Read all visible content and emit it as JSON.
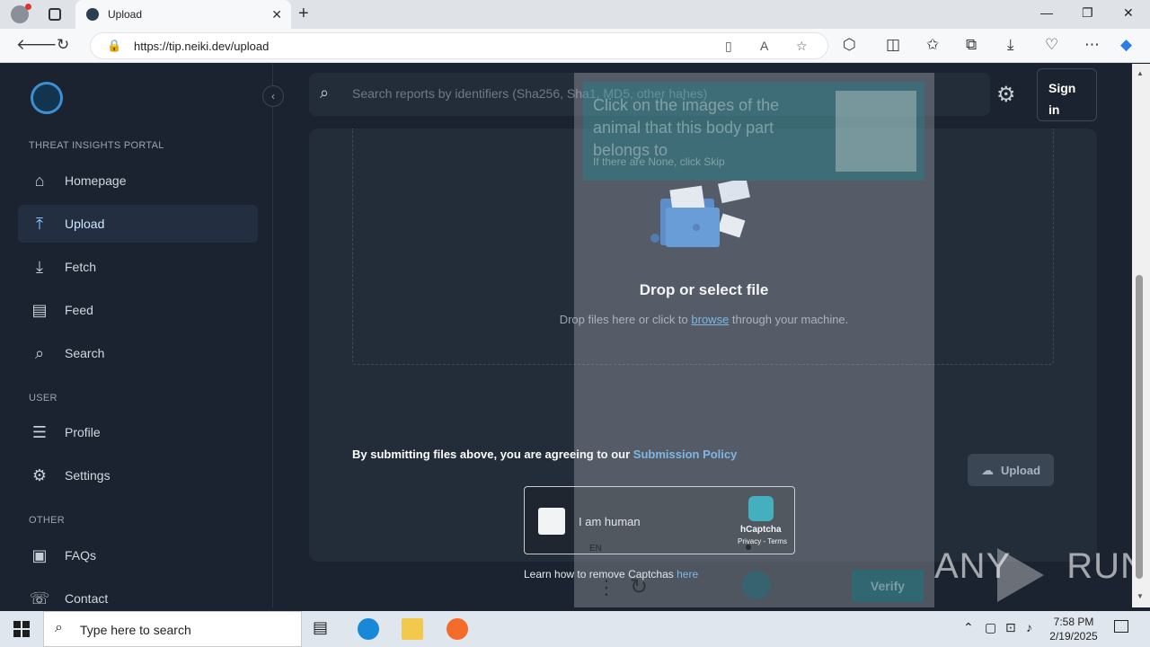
{
  "browser": {
    "tab_title": "Upload",
    "url": "https://tip.neiki.dev/upload",
    "new_tab_symbol": "+",
    "window_controls": [
      "—",
      "❐",
      "✕"
    ]
  },
  "sidebar": {
    "portal_label": "THREAT INSIGHTS PORTAL",
    "main_items": [
      {
        "label": "Homepage",
        "icon": "home-icon"
      },
      {
        "label": "Upload",
        "icon": "upload-icon",
        "active": true
      },
      {
        "label": "Fetch",
        "icon": "download-icon"
      },
      {
        "label": "Feed",
        "icon": "feed-icon"
      },
      {
        "label": "Search",
        "icon": "search-icon"
      }
    ],
    "user_label": "USER",
    "user_items": [
      {
        "label": "Profile",
        "icon": "profile-icon"
      },
      {
        "label": "Settings",
        "icon": "gear-icon"
      }
    ],
    "other_label": "OTHER",
    "other_items": [
      {
        "label": "FAQs",
        "icon": "faq-icon"
      },
      {
        "label": "Contact",
        "icon": "contact-icon"
      }
    ]
  },
  "header": {
    "search_placeholder": "Search reports by identifiers (Sha256, Sha1, MD5, other hahes)",
    "sign_in_line1": "Sign",
    "sign_in_line2": "in"
  },
  "upload": {
    "drop_title": "Drop or select file",
    "drop_sub_before": "Drop files here or click to ",
    "drop_sub_link": "browse",
    "drop_sub_after": " through your machine.",
    "policy_text": "By submitting files above, you are agreeing to our ",
    "policy_link": "Submission Policy",
    "upload_button": "Upload"
  },
  "hcaptcha": {
    "checkbox_label": "I am human",
    "brand": "hCaptcha",
    "links": "Privacy - Terms",
    "learn_text": "Learn how to remove Captchas ",
    "learn_link": "here"
  },
  "challenge": {
    "title": "Click on the images of the animal that this body part belongs to",
    "subtitle": "If there are None, click Skip",
    "language": "EN",
    "verify_button": "Verify"
  },
  "watermark": {
    "left_text": "ANY",
    "right_text": "RUN"
  },
  "taskbar": {
    "search_placeholder": "Type here to search",
    "time": "7:58 PM",
    "date": "2/19/2025"
  },
  "colors": {
    "accent": "#5aa9e6",
    "background": "#1b2330",
    "card": "#232c39",
    "hcaptcha_teal": "#0b9fb3"
  }
}
